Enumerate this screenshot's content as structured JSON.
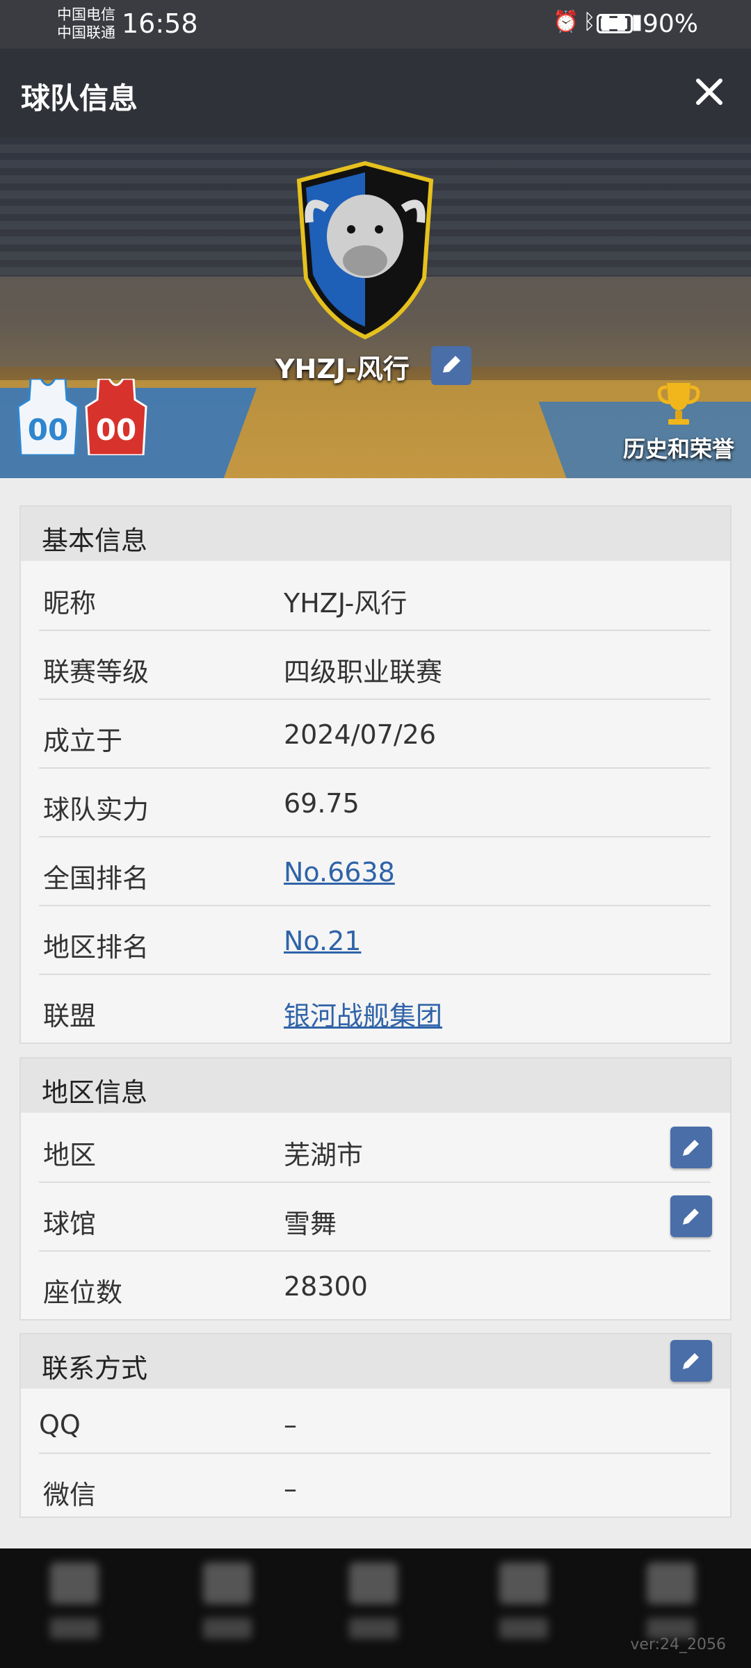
{
  "status_bar": {
    "carrier1": "中国电信",
    "carrier2": "中国联通",
    "time": "16:58",
    "battery": "90%"
  },
  "header": {
    "title": "球队信息",
    "close_icon": "close-icon"
  },
  "banner": {
    "team_name": "YHZJ-风行",
    "jersey_home_number": "00",
    "jersey_away_number": "00",
    "honor_label": "历史和荣誉"
  },
  "basic": {
    "title": "基本信息",
    "rows": [
      {
        "label": "昵称",
        "value": "YHZJ-风行"
      },
      {
        "label": "联赛等级",
        "value": "四级职业联赛"
      },
      {
        "label": "成立于",
        "value": "2024/07/26"
      },
      {
        "label": "球队实力",
        "value": "69.75"
      },
      {
        "label": "全国排名",
        "value": "No.6638"
      },
      {
        "label": "地区排名",
        "value": "No.21"
      },
      {
        "label": "联盟",
        "value": "银河战舰集团"
      }
    ]
  },
  "region": {
    "title": "地区信息",
    "rows": [
      {
        "label": "地区",
        "value": "芜湖市"
      },
      {
        "label": "球馆",
        "value": "雪舞"
      },
      {
        "label": "座位数",
        "value": "28300"
      }
    ]
  },
  "contact": {
    "title": "联系方式",
    "rows": [
      {
        "label": "QQ",
        "value": "–"
      },
      {
        "label": "微信",
        "value": "–"
      }
    ]
  },
  "version": "ver:24_2056",
  "colors": {
    "link": "#2f63a8",
    "edit_button": "#4a6ea8",
    "header": "#2f3238"
  }
}
